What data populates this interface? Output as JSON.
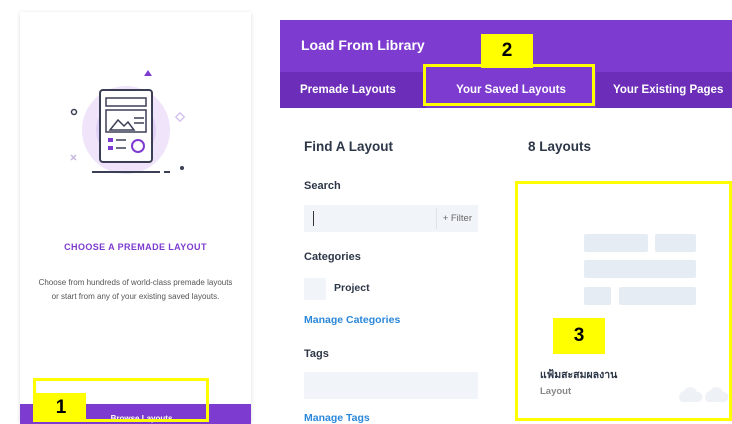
{
  "left_card": {
    "title": "CHOOSE A PREMADE LAYOUT",
    "description": "Choose from hundreds of world-class premade layouts or start from any of your existing saved layouts.",
    "button_label": "Browse Layouts"
  },
  "library": {
    "title": "Load From Library",
    "tabs": [
      {
        "label": "Premade Layouts"
      },
      {
        "label": "Your Saved Layouts"
      },
      {
        "label": "Your Existing Pages"
      }
    ],
    "active_tab": "Your Saved Layouts",
    "find_heading": "Find A Layout",
    "count_heading": "8 Layouts",
    "search_label": "Search",
    "search_value": "",
    "filter_label": "+ Filter",
    "categories_label": "Categories",
    "categories": [
      {
        "label": "Project"
      }
    ],
    "manage_categories": "Manage Categories",
    "tags_label": "Tags",
    "manage_tags": "Manage Tags",
    "layout_card": {
      "name": "แฟ้มสะสมผลงาน",
      "type": "Layout"
    }
  },
  "annotations": [
    {
      "number": "1"
    },
    {
      "number": "2"
    },
    {
      "number": "3"
    }
  ],
  "colors": {
    "accent": "#7e3bd0",
    "tab_bar": "#6c2eb9",
    "link": "#2b87da",
    "highlight": "#ffff00"
  }
}
